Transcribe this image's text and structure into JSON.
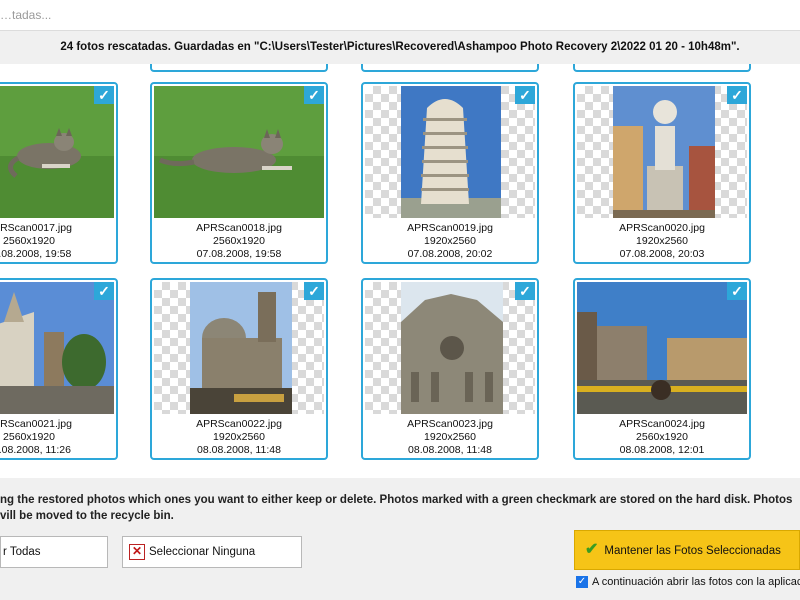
{
  "window": {
    "title": "…tadas..."
  },
  "info_bar": {
    "text": "24 fotos rescatadas. Guardadas en \"C:\\Users\\Tester\\Pictures\\Recovered\\Ashampoo Photo Recovery 2\\2022 01 20 - 10h48m\"."
  },
  "photos": [
    {
      "name": "APRScan0017.jpg",
      "dims": "2560x1920",
      "date": "07.08.2008, 19:58",
      "checked": true,
      "subject": "cat"
    },
    {
      "name": "APRScan0018.jpg",
      "dims": "2560x1920",
      "date": "07.08.2008, 19:58",
      "checked": true,
      "subject": "cat"
    },
    {
      "name": "APRScan0019.jpg",
      "dims": "1920x2560",
      "date": "07.08.2008, 20:02",
      "checked": true,
      "subject": "leaning-tower"
    },
    {
      "name": "APRScan0020.jpg",
      "dims": "1920x2560",
      "date": "07.08.2008, 20:03",
      "checked": true,
      "subject": "statue"
    },
    {
      "name": "APRScan0021.jpg",
      "dims": "2560x1920",
      "date": "08.08.2008, 11:26",
      "checked": true,
      "subject": "church"
    },
    {
      "name": "APRScan0022.jpg",
      "dims": "1920x2560",
      "date": "08.08.2008, 11:48",
      "checked": true,
      "subject": "cathedral-dome"
    },
    {
      "name": "APRScan0023.jpg",
      "dims": "1920x2560",
      "date": "08.08.2008, 11:48",
      "checked": true,
      "subject": "cathedral-facade"
    },
    {
      "name": "APRScan0024.jpg",
      "dims": "2560x1920",
      "date": "08.08.2008, 12:01",
      "checked": true,
      "subject": "piazza"
    }
  ],
  "hint": {
    "line1": "ng the restored photos which ones you want to either keep or delete. Photos marked with a green checkmark are stored on the hard disk. Photos",
    "line2": "vill be moved to the recycle bin."
  },
  "buttons": {
    "select_all": "r Todas",
    "select_none": "Seleccionar Ninguna",
    "keep": "Mantener las Fotos Seleccionadas"
  },
  "open_after": {
    "label": "A continuación abrir las fotos con la aplicació",
    "checked": true
  },
  "colors": {
    "card_border": "#2da7d9",
    "keep_button": "#f6c417",
    "check_green": "#3a9c22"
  }
}
